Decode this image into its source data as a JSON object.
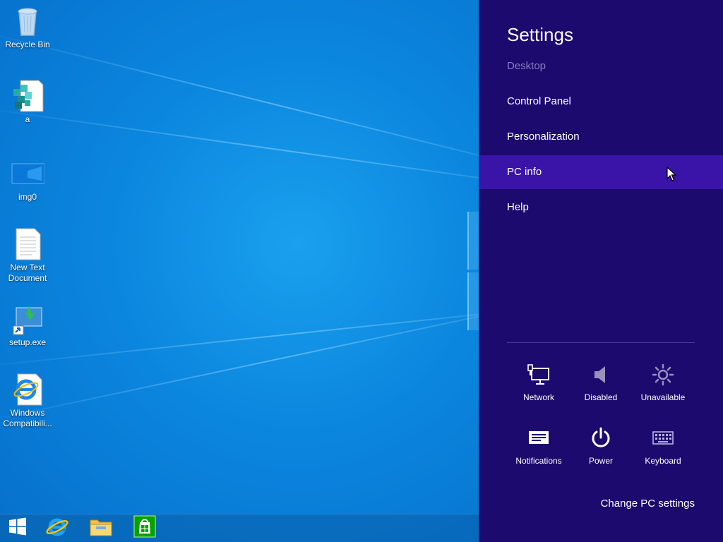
{
  "desktop": {
    "icons": [
      {
        "label": "Recycle Bin",
        "icon": "recycle-bin-icon"
      },
      {
        "label": "a",
        "icon": "registry-file-icon"
      },
      {
        "label": "img0",
        "icon": "image-file-icon"
      },
      {
        "label": "New Text Document",
        "icon": "text-document-icon"
      },
      {
        "label": "setup.exe",
        "icon": "installer-shortcut-icon"
      },
      {
        "label": "Windows Compatibili...",
        "icon": "internet-explorer-shortcut-icon"
      }
    ]
  },
  "taskbar": {
    "items": [
      {
        "icon": "windows-start-icon"
      },
      {
        "icon": "internet-explorer-icon"
      },
      {
        "icon": "file-explorer-icon"
      },
      {
        "icon": "store-icon"
      }
    ]
  },
  "settings": {
    "title": "Settings",
    "menu": [
      {
        "label": "Desktop",
        "state": "disabled"
      },
      {
        "label": "Control Panel"
      },
      {
        "label": "Personalization"
      },
      {
        "label": "PC info",
        "state": "hover"
      },
      {
        "label": "Help"
      }
    ],
    "quick": [
      {
        "label": "Network",
        "icon": "network-icon"
      },
      {
        "label": "Disabled",
        "icon": "speaker-icon"
      },
      {
        "label": "Unavailable",
        "icon": "brightness-icon"
      },
      {
        "label": "Notifications",
        "icon": "notifications-icon"
      },
      {
        "label": "Power",
        "icon": "power-icon"
      },
      {
        "label": "Keyboard",
        "icon": "keyboard-icon"
      }
    ],
    "change_link": "Change PC settings"
  },
  "colors": {
    "settings_bg": "#1c0a6e",
    "hover_bg": "#3a13a8",
    "desktop_blue": "#0b86de"
  }
}
